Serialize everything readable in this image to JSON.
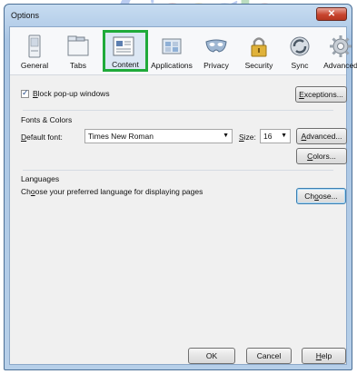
{
  "window": {
    "title": "Options",
    "close_glyph": "✕"
  },
  "toolbar": {
    "panes": [
      {
        "label": "General",
        "icon": "general-icon"
      },
      {
        "label": "Tabs",
        "icon": "tabs-icon"
      },
      {
        "label": "Content",
        "icon": "content-icon",
        "selected": true
      },
      {
        "label": "Applications",
        "icon": "applications-icon"
      },
      {
        "label": "Privacy",
        "icon": "privacy-mask-icon"
      },
      {
        "label": "Security",
        "icon": "padlock-icon"
      },
      {
        "label": "Sync",
        "icon": "sync-icon"
      },
      {
        "label": "Advanced",
        "icon": "gear-icon"
      }
    ]
  },
  "popups": {
    "checkbox_label_rest": "lock pop-up windows",
    "checkbox_accel": "B",
    "checked": true,
    "exceptions_accel": "E",
    "exceptions_rest": "xceptions..."
  },
  "fonts": {
    "group_title": "Fonts & Colors",
    "default_font_accel": "D",
    "default_font_rest": "efault font:",
    "default_font_value": "Times New Roman",
    "size_accel": "S",
    "size_rest": "ize:",
    "size_value": "16",
    "advanced_accel": "A",
    "advanced_rest": "dvanced...",
    "colors_accel": "C",
    "colors_rest": "olors..."
  },
  "languages": {
    "group_title": "Languages",
    "desc_pre": "Ch",
    "desc_accel": "o",
    "desc_rest": "ose your preferred language for displaying pages",
    "choose_pre": "Ch",
    "choose_accel": "o",
    "choose_rest": "ose..."
  },
  "footer": {
    "ok_label": "OK",
    "cancel_label": "Cancel",
    "help_accel": "H",
    "help_rest": "elp"
  },
  "colors": {
    "selection_highlight": "#1faa3a",
    "titlebar": "#b6cfe9",
    "close": "#c8452f"
  },
  "background": {
    "logo_letters": [
      "G",
      "o",
      "o",
      "g",
      "l",
      "e"
    ]
  }
}
